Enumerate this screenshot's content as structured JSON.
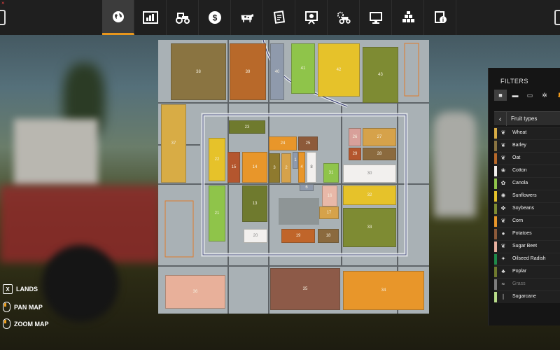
{
  "toolbar": {
    "tabs": [
      {
        "name": "map-tab",
        "icon": "globe-icon",
        "active": true
      },
      {
        "name": "statistics-tab",
        "icon": "chart-icon",
        "active": false
      },
      {
        "name": "vehicles-tab",
        "icon": "tractor-icon",
        "active": false
      },
      {
        "name": "finances-tab",
        "icon": "dollar-icon",
        "active": false
      },
      {
        "name": "animals-tab",
        "icon": "cow-icon",
        "active": false
      },
      {
        "name": "contracts-tab",
        "icon": "contracts-icon",
        "active": false
      },
      {
        "name": "production-tab",
        "icon": "board-icon",
        "active": false
      },
      {
        "name": "settings-tab",
        "icon": "gear-tractor-icon",
        "active": false
      },
      {
        "name": "monitor-tab",
        "icon": "monitor-icon",
        "active": false
      },
      {
        "name": "stack-tab",
        "icon": "stack-icon",
        "active": false
      },
      {
        "name": "help-tab",
        "icon": "help-icon",
        "active": false
      }
    ]
  },
  "map": {
    "fields": [
      {
        "id": "38",
        "color": "#8a7441"
      },
      {
        "id": "39",
        "color": "#b8692a"
      },
      {
        "id": "40",
        "color": "#8f9aac"
      },
      {
        "id": "41",
        "color": "#8fc44a"
      },
      {
        "id": "42",
        "color": "#e6c22a"
      },
      {
        "id": "43",
        "color": "#7e8b33"
      },
      {
        "id": "37",
        "color": "#d8ac45"
      },
      {
        "id": "23",
        "color": "#6f7a2e"
      },
      {
        "id": "24",
        "color": "#e8962a"
      },
      {
        "id": "25",
        "color": "#8d5a3a"
      },
      {
        "id": "26",
        "color": "#d8a09a"
      },
      {
        "id": "27",
        "color": "#d6a24a"
      },
      {
        "id": "29",
        "color": "#b4562e"
      },
      {
        "id": "28",
        "color": "#8b6a3e"
      },
      {
        "id": "22",
        "color": "#e6c22a"
      },
      {
        "id": "15",
        "color": "#b4562e"
      },
      {
        "id": "14",
        "color": "#e8962a"
      },
      {
        "id": "3",
        "color": "#8f7a2e"
      },
      {
        "id": "2",
        "color": "#d6a24a"
      },
      {
        "id": "1",
        "color": "#8f9aac"
      },
      {
        "id": "4",
        "color": "#e8962a"
      },
      {
        "id": "8",
        "color": "#f2f0ee"
      },
      {
        "id": "31",
        "color": "#8fc44a"
      },
      {
        "id": "30",
        "color": "#f2f0ee"
      },
      {
        "id": "21",
        "color": "#8fc44a"
      },
      {
        "id": "13",
        "color": "#6f7a2e"
      },
      {
        "id": "6",
        "color": "#8f9aac"
      },
      {
        "id": "16",
        "color": "#e8b8a8"
      },
      {
        "id": "32",
        "color": "#e6c22a"
      },
      {
        "id": "17",
        "color": "#d6a24a"
      },
      {
        "id": "20",
        "color": "#f2f0ee"
      },
      {
        "id": "19",
        "color": "#c0652a"
      },
      {
        "id": "18",
        "color": "#8b6a3e"
      },
      {
        "id": "33",
        "color": "#7e8b33"
      },
      {
        "id": "36",
        "color": "#e8b09a"
      },
      {
        "id": "35",
        "color": "#8d5a48"
      },
      {
        "id": "34",
        "color": "#e8962a"
      }
    ]
  },
  "filters": {
    "title": "FILTERS",
    "subheader": "Fruit types",
    "crops": [
      {
        "label": "Wheat",
        "color": "#d8ac45"
      },
      {
        "label": "Barley",
        "color": "#8a7441"
      },
      {
        "label": "Oat",
        "color": "#b8692a"
      },
      {
        "label": "Cotton",
        "color": "#f2f0ee"
      },
      {
        "label": "Canola",
        "color": "#8fc44a"
      },
      {
        "label": "Sunflowers",
        "color": "#e6c22a"
      },
      {
        "label": "Soybeans",
        "color": "#7e8b33"
      },
      {
        "label": "Corn",
        "color": "#e8962a"
      },
      {
        "label": "Potatoes",
        "color": "#8d5a3a"
      },
      {
        "label": "Sugar Beet",
        "color": "#e8b0a0"
      },
      {
        "label": "Oilseed Radish",
        "color": "#1f8a4a"
      },
      {
        "label": "Poplar",
        "color": "#6f7a2e"
      },
      {
        "label": "Grass",
        "color": "#7d7d7d"
      },
      {
        "label": "Sugarcane",
        "color": "#b8dc8a"
      }
    ]
  },
  "controls": {
    "lands_key": "X",
    "lands_label": "LANDS",
    "pan_label": "PAN MAP",
    "zoom_label": "ZOOM MAP"
  }
}
